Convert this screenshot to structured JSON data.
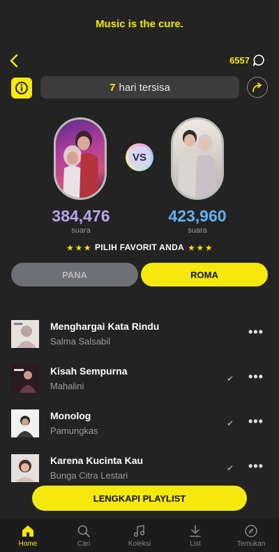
{
  "header": {
    "tagline": "Music is the cure.",
    "coins": "6557",
    "days_value": "7",
    "days_label": "hari tersisa"
  },
  "battle": {
    "vs_label": "VS",
    "left": {
      "votes": "384,476",
      "votes_label": "suara"
    },
    "right": {
      "votes": "423,960",
      "votes_label": "suara"
    },
    "prompt": "PILIH FAVORIT ANDA",
    "stars": "★ ★ ★",
    "option_a": "PANA",
    "option_b": "ROMA"
  },
  "songs": [
    {
      "title": "Menghargai Kata Rindu",
      "artist": "Salma Salsabil",
      "checked": false
    },
    {
      "title": "Kisah Sempurna",
      "artist": "Mahalini",
      "checked": true
    },
    {
      "title": "Monolog",
      "artist": "Pamungkas",
      "checked": true
    },
    {
      "title": "Karena Kucinta Kau",
      "artist": "Bunga Citra Lestari",
      "checked": true
    }
  ],
  "song_more": "•••",
  "song_check": "✔",
  "complete_button": "LENGKAPI PLAYLIST",
  "nav": [
    {
      "label": "Home",
      "icon": "home-icon",
      "active": true
    },
    {
      "label": "Cari",
      "icon": "search-icon",
      "active": false
    },
    {
      "label": "Koleksi",
      "icon": "music-note-icon",
      "active": false
    },
    {
      "label": "List",
      "icon": "download-icon",
      "active": false
    },
    {
      "label": "Temukan",
      "icon": "compass-icon",
      "active": false
    }
  ],
  "colors": {
    "accent": "#f5e80e",
    "left_score": "#b9a5ee",
    "right_score": "#5fb2f2",
    "background": "#232323"
  }
}
